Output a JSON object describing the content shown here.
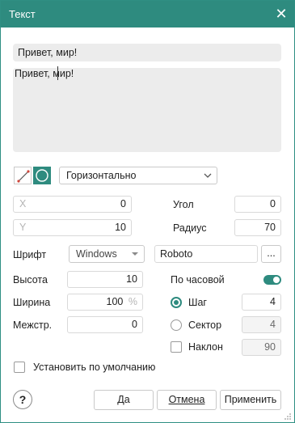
{
  "window": {
    "title": "Текст",
    "close_glyph": "✕"
  },
  "preview": {
    "line_text": "Привет, мир!",
    "area_text": "Привет, мир!"
  },
  "toolbar": {
    "orientation_value": "Горизонтально"
  },
  "geometry": {
    "x_label": "X",
    "x_value": "0",
    "y_label": "Y",
    "y_value": "10",
    "angle_label": "Угол",
    "angle_value": "0",
    "radius_label": "Радиус",
    "radius_value": "70"
  },
  "font": {
    "label": "Шрифт",
    "source_value": "Windows",
    "family_value": "Roboto",
    "browse_label": "..."
  },
  "size": {
    "height_label": "Высота",
    "height_value": "10",
    "width_label": "Ширина",
    "width_value": "100",
    "width_unit": "%",
    "spacing_label": "Межстр.",
    "spacing_value": "0"
  },
  "options": {
    "clockwise_label": "По часовой",
    "clockwise_on": true,
    "step_label": "Шаг",
    "step_value": "4",
    "sector_label": "Сектор",
    "sector_value": "4",
    "tilt_label": "Наклон",
    "tilt_value": "90"
  },
  "default_checkbox_label": "Установить по умолчанию",
  "buttons": {
    "help": "?",
    "ok": "Да",
    "cancel": "Отмена",
    "apply": "Применить"
  },
  "colors": {
    "accent": "#2e8b7f"
  }
}
